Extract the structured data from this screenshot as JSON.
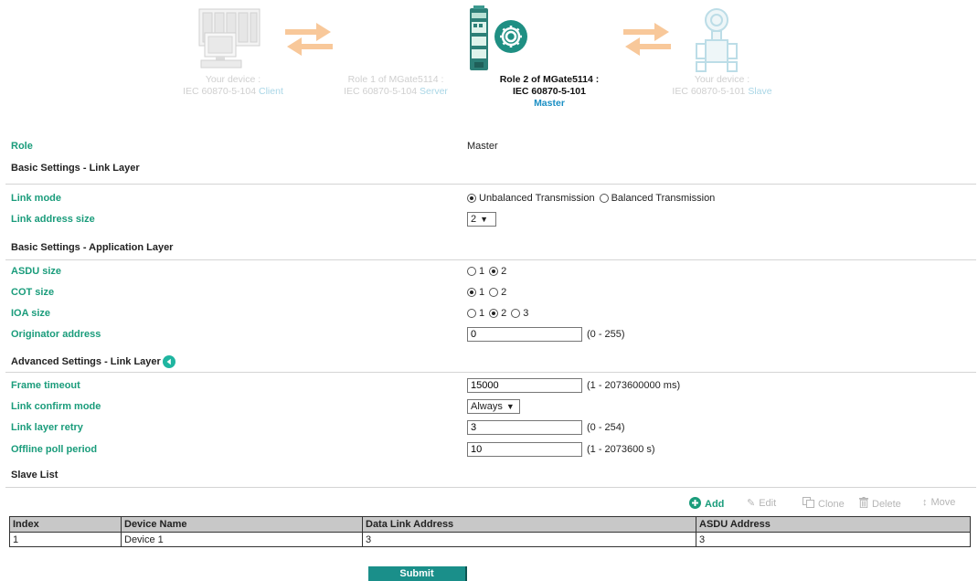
{
  "diagram": {
    "devices": [
      {
        "line1": "Your device :",
        "line2": "IEC 60870-5-104",
        "accent": "Client"
      },
      {
        "line1": "Role 1 of MGate5114 :",
        "line2": "IEC 60870-5-104",
        "accent": "Server"
      },
      {
        "line1": "Role 2 of MGate5114 :",
        "line2": "IEC 60870-5-101",
        "accent": "Master"
      },
      {
        "line1": "Your device :",
        "line2": "IEC 60870-5-101",
        "accent": "Slave"
      }
    ]
  },
  "role": {
    "label": "Role",
    "value": "Master"
  },
  "basic_link": {
    "title": "Basic Settings - Link Layer",
    "link_mode": {
      "label": "Link mode",
      "options": [
        "Unbalanced Transmission",
        "Balanced Transmission"
      ],
      "selected": 0
    },
    "link_address_size": {
      "label": "Link address size",
      "value": "2"
    }
  },
  "basic_app": {
    "title": "Basic Settings - Application Layer",
    "asdu_size": {
      "label": "ASDU size",
      "options": [
        "1",
        "2"
      ],
      "selected": 1
    },
    "cot_size": {
      "label": "COT size",
      "options": [
        "1",
        "2"
      ],
      "selected": 0
    },
    "ioa_size": {
      "label": "IOA size",
      "options": [
        "1",
        "2",
        "3"
      ],
      "selected": 1
    },
    "originator": {
      "label": "Originator address",
      "value": "0",
      "range": "(0 - 255)"
    }
  },
  "advanced_link": {
    "title": "Advanced Settings - Link Layer",
    "frame_timeout": {
      "label": "Frame timeout",
      "value": "15000",
      "range": "(1 - 2073600000 ms)"
    },
    "link_confirm_mode": {
      "label": "Link confirm mode",
      "value": "Always"
    },
    "link_layer_retry": {
      "label": "Link layer retry",
      "value": "3",
      "range": "(0 - 254)"
    },
    "offline_poll_period": {
      "label": "Offline poll period",
      "value": "10",
      "range": "(1 - 2073600 s)"
    }
  },
  "slave_list": {
    "title": "Slave List",
    "toolbar": {
      "add": "Add",
      "edit": "Edit",
      "clone": "Clone",
      "delete": "Delete",
      "move": "Move"
    },
    "columns": [
      "Index",
      "Device Name",
      "Data Link Address",
      "ASDU Address"
    ],
    "rows": [
      [
        "1",
        "Device 1",
        "3",
        "3"
      ]
    ]
  },
  "submit_label": "Submit",
  "colors": {
    "label_green": "#1a9c7b",
    "submit_bg": "#1a8f8a",
    "arrow_orange": "#f8c89a",
    "accent_blue": "#1a8fc4"
  }
}
